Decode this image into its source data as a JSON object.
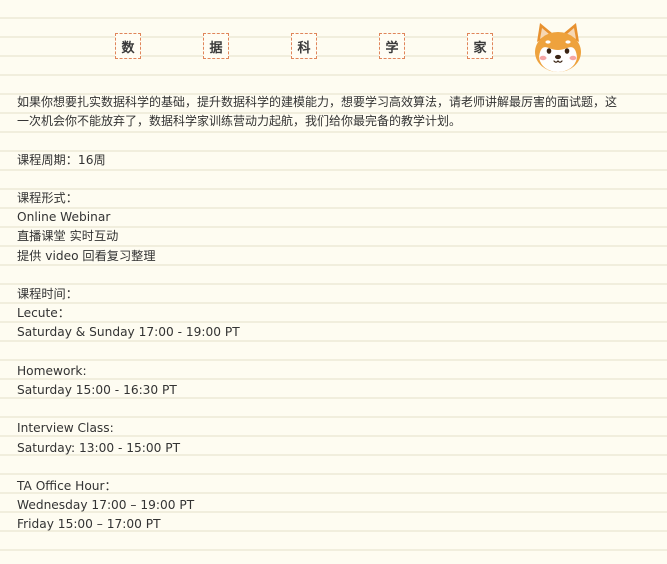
{
  "header": {
    "title_chars": [
      "数",
      "据",
      "科",
      "学",
      "家"
    ],
    "mascot_icon": "shiba-dog-icon"
  },
  "intro": {
    "line1": "如果你想要扎实数据科学的基础，提升数据科学的建模能力，想要学习高效算法，请老师讲解最厉害的面试题，这",
    "line2": "一次机会你不能放弃了，数据科学家训练营动力起航，我们给你最完备的教学计划。"
  },
  "course": {
    "period": "课程周期：16周",
    "format_label": "课程形式：",
    "format_items": [
      "Online Webinar",
      "直播课堂 实时互动",
      "提供 video 回看复习整理"
    ],
    "time_label": "课程时间：",
    "lecture_label": "Lecute：",
    "lecture_time": "Saturday & Sunday 17:00 - 19:00 PT",
    "homework_label": "Homework:",
    "homework_time": "Saturday 15:00 - 16:30 PT",
    "interview_label": "Interview Class:",
    "interview_time": "Saturday: 13:00 - 15:00 PT",
    "ta_label": "TA Office Hour：",
    "ta_times": [
      "Wednesday 17:00 – 19:00 PT",
      "Friday 15:00 – 17:00 PT"
    ]
  },
  "colors": {
    "background": "#fefcf1",
    "rule": "#f1eedd",
    "accent_border": "#e0855a",
    "text": "#333333"
  }
}
